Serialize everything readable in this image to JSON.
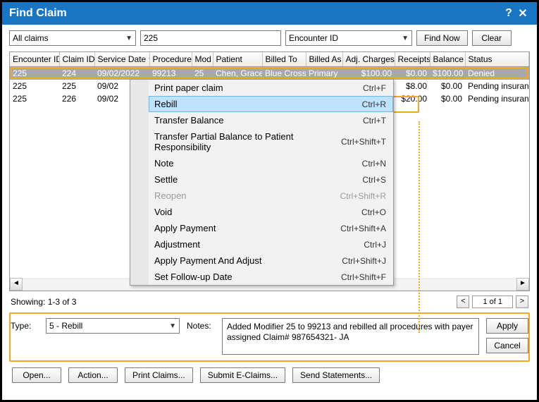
{
  "title": "Find Claim",
  "toolbar": {
    "filter": "All claims",
    "search_value": "225",
    "search_by": "Encounter ID",
    "find_label": "Find Now",
    "clear_label": "Clear"
  },
  "columns": [
    "Encounter ID",
    "Claim ID",
    "Service Date",
    "Procedure",
    "Mod",
    "Patient",
    "Billed To",
    "Billed As",
    "Adj. Charges",
    "Receipts",
    "Balance",
    "Status"
  ],
  "rows": [
    {
      "enc": "225",
      "claim": "224",
      "date": "09/02/2022",
      "proc": "99213",
      "mod": "25",
      "patient": "Chen, Grace",
      "billedto": "Blue Cross",
      "billedas": "Primary",
      "adj": "$100.00",
      "rec": "$0.00",
      "bal": "$100.00",
      "status": "Denied",
      "sel": true
    },
    {
      "enc": "225",
      "claim": "225",
      "date": "09/02",
      "proc": "",
      "mod": "",
      "patient": "",
      "billedto": "",
      "billedas": "",
      "adj": "",
      "rec": "$8.00",
      "bal": "$0.00",
      "status": "Pending insurance",
      "sel": false
    },
    {
      "enc": "225",
      "claim": "226",
      "date": "09/02",
      "proc": "",
      "mod": "",
      "patient": "",
      "billedto": "",
      "billedas": "",
      "adj": "",
      "rec": "$20.00",
      "bal": "$0.00",
      "status": "Pending insurance",
      "sel": false
    }
  ],
  "context_menu": [
    {
      "label": "Print paper claim",
      "shortcut": "Ctrl+F",
      "hi": false,
      "dis": false
    },
    {
      "label": "Rebill",
      "shortcut": "Ctrl+R",
      "hi": true,
      "dis": false
    },
    {
      "label": "Transfer Balance",
      "shortcut": "Ctrl+T",
      "hi": false,
      "dis": false
    },
    {
      "label": "Transfer Partial Balance to Patient Responsibility",
      "shortcut": "Ctrl+Shift+T",
      "hi": false,
      "dis": false
    },
    {
      "label": "Note",
      "shortcut": "Ctrl+N",
      "hi": false,
      "dis": false
    },
    {
      "label": "Settle",
      "shortcut": "Ctrl+S",
      "hi": false,
      "dis": false
    },
    {
      "label": "Reopen",
      "shortcut": "Ctrl+Shift+R",
      "hi": false,
      "dis": true
    },
    {
      "label": "Void",
      "shortcut": "Ctrl+O",
      "hi": false,
      "dis": false
    },
    {
      "label": "Apply Payment",
      "shortcut": "Ctrl+Shift+A",
      "hi": false,
      "dis": false
    },
    {
      "label": "Adjustment",
      "shortcut": "Ctrl+J",
      "hi": false,
      "dis": false
    },
    {
      "label": "Apply Payment And Adjust",
      "shortcut": "Ctrl+Shift+J",
      "hi": false,
      "dis": false
    },
    {
      "label": "Set Follow-up Date",
      "shortcut": "Ctrl+Shift+F",
      "hi": false,
      "dis": false
    }
  ],
  "showing": "Showing: 1-3 of 3",
  "page": "1 of 1",
  "form": {
    "type_label": "Type:",
    "type_value": "5 - Rebill",
    "notes_label": "Notes:",
    "notes_value": "Added Modifier 25 to 99213 and rebilled all procedures with payer assigned Claim# 987654321- JA",
    "apply": "Apply",
    "cancel": "Cancel"
  },
  "buttons": {
    "open": "Open...",
    "action": "Action...",
    "print": "Print Claims...",
    "submit": "Submit E-Claims...",
    "send": "Send Statements..."
  }
}
